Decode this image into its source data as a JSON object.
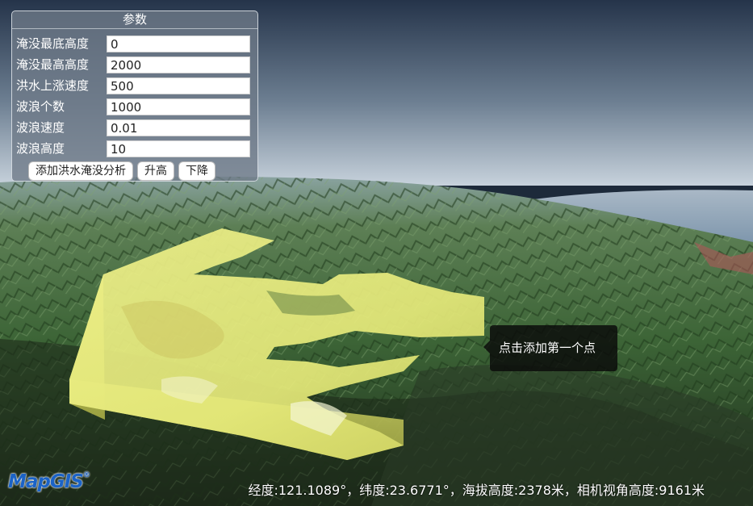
{
  "panel": {
    "title": "参数",
    "params": [
      {
        "label": "淹没最底高度",
        "value": "0"
      },
      {
        "label": "淹没最高高度",
        "value": "2000"
      },
      {
        "label": "洪水上涨速度",
        "value": "500"
      },
      {
        "label": "波浪个数",
        "value": "1000"
      },
      {
        "label": "波浪速度",
        "value": "0.01"
      },
      {
        "label": "波浪高度",
        "value": "10"
      }
    ],
    "buttons": {
      "add": "添加洪水淹没分析",
      "raise": "升高",
      "lower": "下降"
    }
  },
  "tooltip": {
    "text": "点击添加第一个点"
  },
  "logo": {
    "text": "MapGIS",
    "mark": "®"
  },
  "status": {
    "text": "经度:121.1089°，纬度:23.6771°，海拔高度:2378米，相机视角高度:9161米"
  },
  "colors": {
    "sky_top": "#25344a",
    "sky_horizon": "#c7d2dc",
    "terrain": "#3c6436",
    "flood": "#e6ea7a",
    "logo": "#1b63c7"
  }
}
